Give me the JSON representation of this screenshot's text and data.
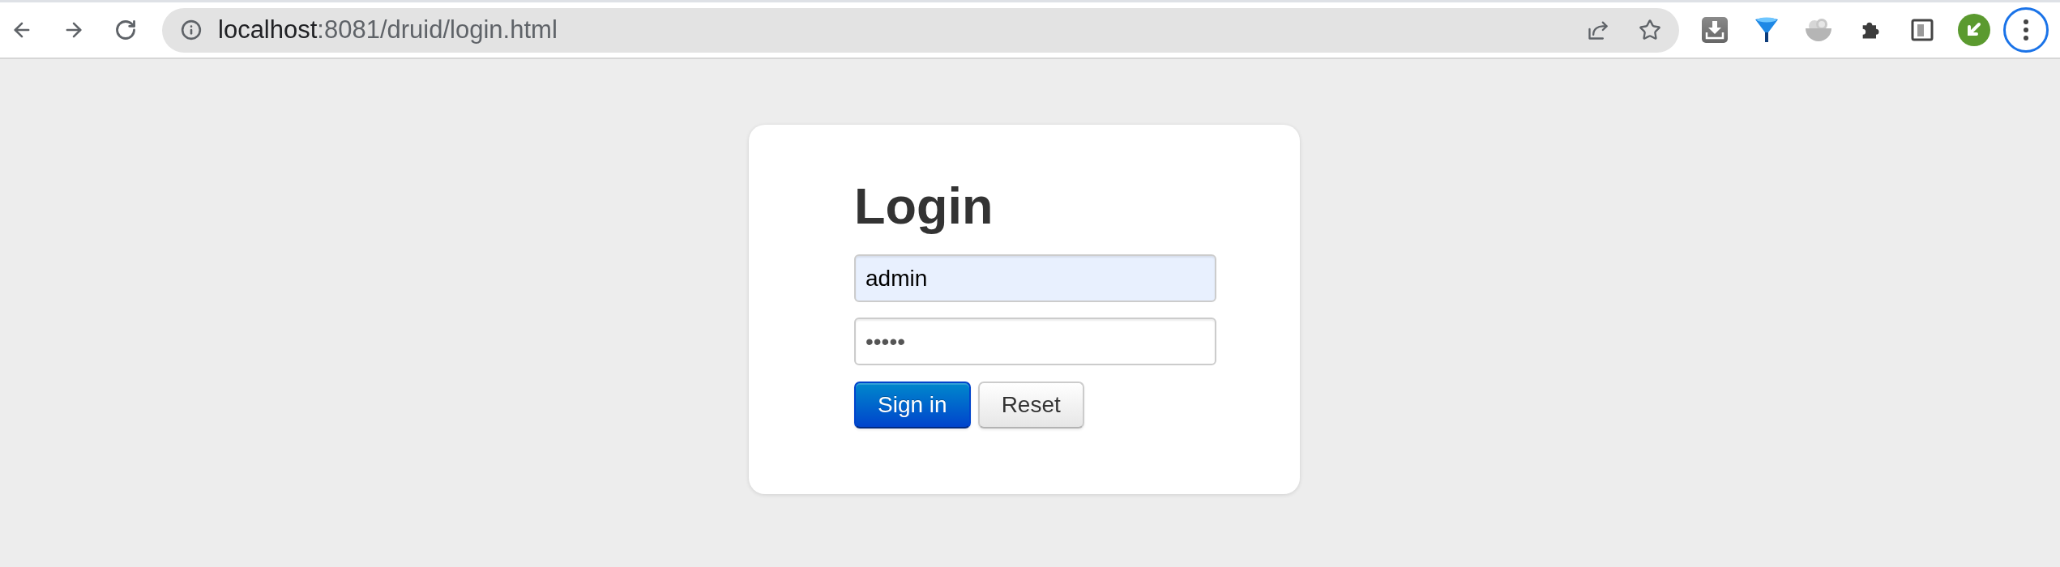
{
  "browser": {
    "url": {
      "host": "localhost",
      "path": ":8081/druid/login.html"
    }
  },
  "login": {
    "title": "Login",
    "username": {
      "value": "admin",
      "autofilled": true
    },
    "password": {
      "value": "•••••",
      "autofilled": false
    },
    "buttons": [
      {
        "label": "Sign in",
        "kind": "primary"
      },
      {
        "label": "Reset",
        "kind": "default"
      }
    ]
  }
}
